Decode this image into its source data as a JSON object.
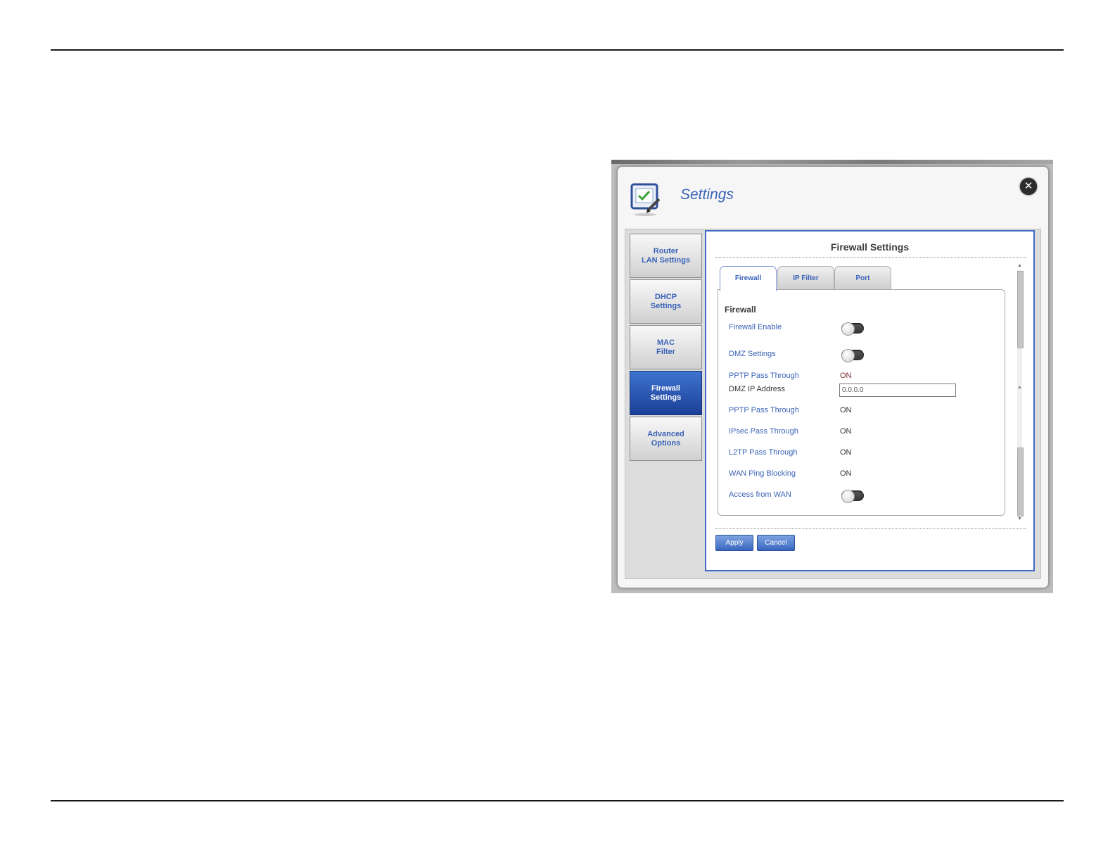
{
  "dialog": {
    "title": "Settings",
    "close_label": "✕"
  },
  "sidebar": {
    "items": [
      {
        "label": "Router\nLAN Settings",
        "active": false
      },
      {
        "label": "DHCP\nSettings",
        "active": false
      },
      {
        "label": "MAC\nFilter",
        "active": false
      },
      {
        "label": "Firewall\nSettings",
        "active": true
      },
      {
        "label": "Advanced\nOptions",
        "active": false
      }
    ]
  },
  "content": {
    "title": "Firewall Settings",
    "tabs": [
      "Firewall",
      "IP Filter",
      "Port"
    ],
    "active_tab": "Firewall",
    "panel": {
      "heading": "Firewall",
      "rows": {
        "firewall_enable": {
          "label": "Firewall Enable"
        },
        "dmz_settings": {
          "label": "DMZ Settings"
        },
        "pptp_overlap": {
          "label": "PPTP Pass Through",
          "value": "ON"
        },
        "dmz_ip": {
          "label": "DMZ IP Address",
          "value": "0.0.0.0"
        },
        "pptp": {
          "label": "PPTP Pass Through",
          "value": "ON"
        },
        "ipsec": {
          "label": "IPsec Pass Through",
          "value": "ON"
        },
        "l2tp": {
          "label": "L2TP Pass Through",
          "value": "ON"
        },
        "wan_ping": {
          "label": "WAN Ping Blocking",
          "value": "ON"
        },
        "access_wan": {
          "label": "Access from WAN"
        }
      }
    },
    "buttons": {
      "apply": "Apply",
      "cancel": "Cancel"
    }
  },
  "footer": {
    "tiny_text": ""
  },
  "colors": {
    "accent": "#3a63b8",
    "active_tab_bg": "#1c3f96"
  }
}
